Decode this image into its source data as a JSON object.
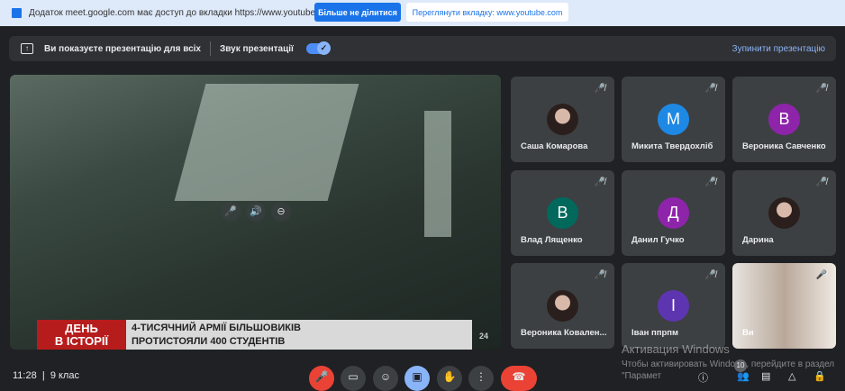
{
  "banner": {
    "message": "Додаток meet.google.com має доступ до вкладки https://www.youtube.com",
    "stop_sharing": "Більше не ділитися",
    "view_tab": "Переглянути вкладку: www.youtube.com"
  },
  "presentation_bar": {
    "status": "Ви показуєте презентацію для всіх",
    "audio_label": "Звук презентації",
    "audio_on": true,
    "stop": "Зупинити презентацію"
  },
  "video": {
    "headline_badge_1": "ДЕНЬ",
    "headline_badge_2": "В ІСТОРІЇ",
    "headline_1": "4-ТИСЯЧНИЙ АРМІЇ БІЛЬШОВИКІВ",
    "headline_2": "ПРОТИСТОЯЛИ 400 СТУДЕНТІВ",
    "channel_logo": "24"
  },
  "participants": [
    {
      "name": "Саша Комарова",
      "initial": "",
      "color": ""
    },
    {
      "name": "Микита Твердохліб",
      "initial": "M",
      "color": "#1e88e5"
    },
    {
      "name": "Вероника Савченко",
      "initial": "В",
      "color": "#8e24aa"
    },
    {
      "name": "Влад Лященко",
      "initial": "В",
      "color": "#00695c"
    },
    {
      "name": "Данил Гучко",
      "initial": "Д",
      "color": "#8e24aa"
    },
    {
      "name": "Дарина",
      "initial": "",
      "color": ""
    },
    {
      "name": "Вероника Ковален...",
      "initial": "",
      "color": ""
    },
    {
      "name": "Іван ппрпм",
      "initial": "І",
      "color": "#5e35b1"
    },
    {
      "name": "Ви",
      "initial": "",
      "color": ""
    }
  ],
  "bottom": {
    "time": "11:28",
    "meeting": "9 клас",
    "participant_count": "10"
  },
  "watermark": {
    "title": "Активация Windows",
    "text": "Чтобы активировать Windows, перейдите в раздел \"Парамет"
  }
}
